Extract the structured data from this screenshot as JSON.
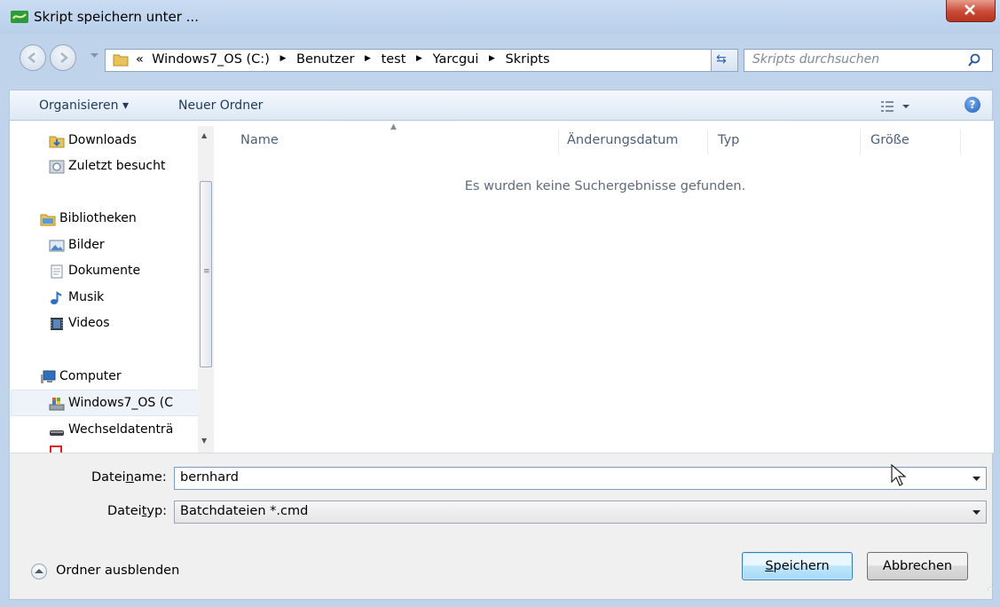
{
  "window": {
    "title": "Skript speichern unter ...",
    "close_tooltip": "Schließen"
  },
  "address": {
    "prefix": "«",
    "breadcrumbs": [
      "Windows7_OS (C:)",
      "Benutzer",
      "test",
      "Yarcgui",
      "Skripts"
    ],
    "search_placeholder": "Skripts durchsuchen"
  },
  "toolbar": {
    "organize_label": "Organisieren ▾",
    "new_folder_label": "Neuer Ordner",
    "help_label": "?"
  },
  "nav": {
    "items": [
      {
        "label": "Downloads",
        "icon": "downloads-folder-icon"
      },
      {
        "label": "Zuletzt besucht",
        "icon": "recent-places-icon"
      },
      {
        "label": "Bibliotheken",
        "icon": "libraries-icon"
      },
      {
        "label": "Bilder",
        "icon": "pictures-icon"
      },
      {
        "label": "Dokumente",
        "icon": "documents-icon"
      },
      {
        "label": "Musik",
        "icon": "music-icon"
      },
      {
        "label": "Videos",
        "icon": "videos-icon"
      },
      {
        "label": "Computer",
        "icon": "computer-icon"
      },
      {
        "label": "Windows7_OS (C",
        "icon": "drive-icon"
      },
      {
        "label": "Wechseldatenträ",
        "icon": "removable-drive-icon"
      }
    ],
    "selected_index": 8
  },
  "columns": {
    "name": "Name",
    "date": "Änderungsdatum",
    "type": "Typ",
    "size": "Größe"
  },
  "empty_message": "Es wurden keine Suchergebnisse gefunden.",
  "fields": {
    "filename_label_pre": "Datei",
    "filename_label_key": "n",
    "filename_label_post": "ame:",
    "filename_value": "bernhard",
    "filetype_label_pre": "Datei",
    "filetype_label_key": "t",
    "filetype_label_post": "yp:",
    "filetype_value": "Batchdateien *.cmd"
  },
  "footer": {
    "hide_folders_label": "Ordner ausblenden",
    "save_label_key": "S",
    "save_label_rest": "peichern",
    "cancel_label": "Abbrechen"
  },
  "colors": {
    "frame": "#bfd3ea",
    "close_button": "#c94a35",
    "link_text": "#1e395b",
    "header_text": "#4c607a"
  }
}
